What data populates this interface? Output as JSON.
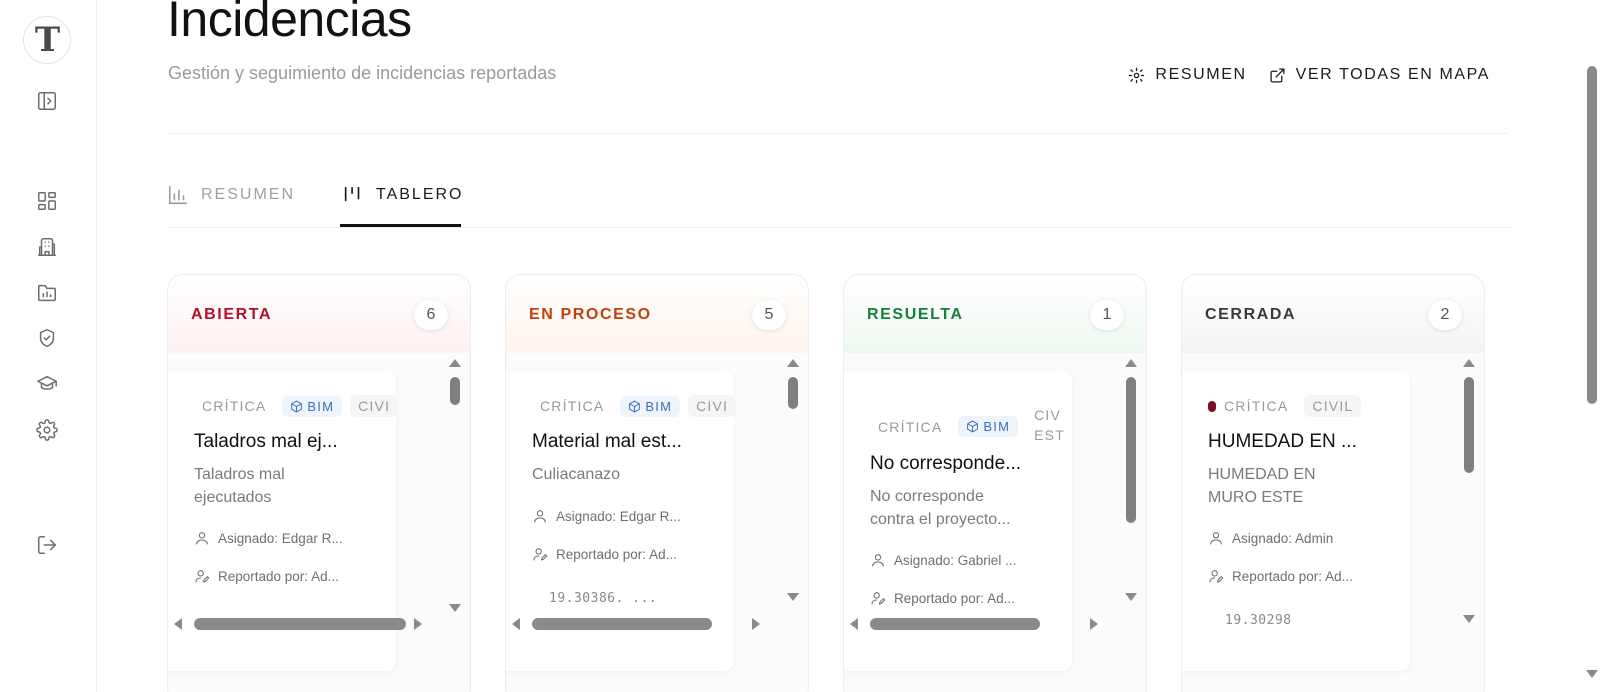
{
  "sidebar": {
    "logo_letter": "T",
    "icons": [
      "panel-expand-icon",
      "dashboard-icon",
      "building-icon",
      "folder-chart-icon",
      "shield-check-icon",
      "graduation-cap-icon",
      "settings-icon",
      "logout-icon"
    ]
  },
  "header": {
    "title": "Incidencias",
    "subtitle": "Gestión y seguimiento de incidencias reportadas",
    "actions": {
      "summary_label": "RESUMEN",
      "map_label": "VER TODAS EN MAPA"
    }
  },
  "tabs": {
    "resumen": "RESUMEN",
    "tablero": "TABLERO",
    "active": "TABLERO"
  },
  "columns": [
    {
      "title": "ABIERTA",
      "count": "6",
      "color": "#b1102a",
      "card": {
        "priority": "CRÍTICA",
        "tag_bim": "BIM",
        "tag_civil": "CIVI",
        "title": "Taladros mal ej...",
        "description": "Taladros mal ejecutados",
        "assigned": "Asignado: Edgar R...",
        "reported": "Reportado por: Ad..."
      }
    },
    {
      "title": "EN PROCESO",
      "count": "5",
      "color": "#c2410c",
      "card": {
        "priority": "CRÍTICA",
        "tag_bim": "BIM",
        "tag_civil": "CIVI",
        "title": "Material mal est...",
        "description": "Culiacanazo",
        "assigned": "Asignado: Edgar R...",
        "reported": "Reportado por: Ad...",
        "coords": "19.30386. ..."
      }
    },
    {
      "title": "RESUELTA",
      "count": "1",
      "color": "#15803d",
      "card": {
        "priority": "CRÍTICA",
        "tag_bim": "BIM",
        "tag_civil": "CIV",
        "tag_civil_2": "EST",
        "title": "No corresponde...",
        "description": "No corresponde contra el proyecto...",
        "assigned": "Asignado: Gabriel ...",
        "reported": "Reportado por: Ad..."
      }
    },
    {
      "title": "CERRADA",
      "count": "2",
      "color": "#3a3a3a",
      "card": {
        "priority": "CRÍTICA",
        "tag_civil": "CIVIL",
        "title": "HUMEDAD EN ...",
        "description": "HUMEDAD EN MURO ESTE",
        "assigned": "Asignado: Admin",
        "reported": "Reportado por: Ad...",
        "coords": "19.30298"
      }
    }
  ],
  "colors": {
    "abierta_tint": "#fdf1f1",
    "proceso_tint": "#fdf4ec",
    "resuelta_tint": "#eef8f1",
    "cerrada_tint": "#f4f4f4",
    "bim_blue": "#3b6fb8",
    "critical_dot": "#7a1028"
  }
}
